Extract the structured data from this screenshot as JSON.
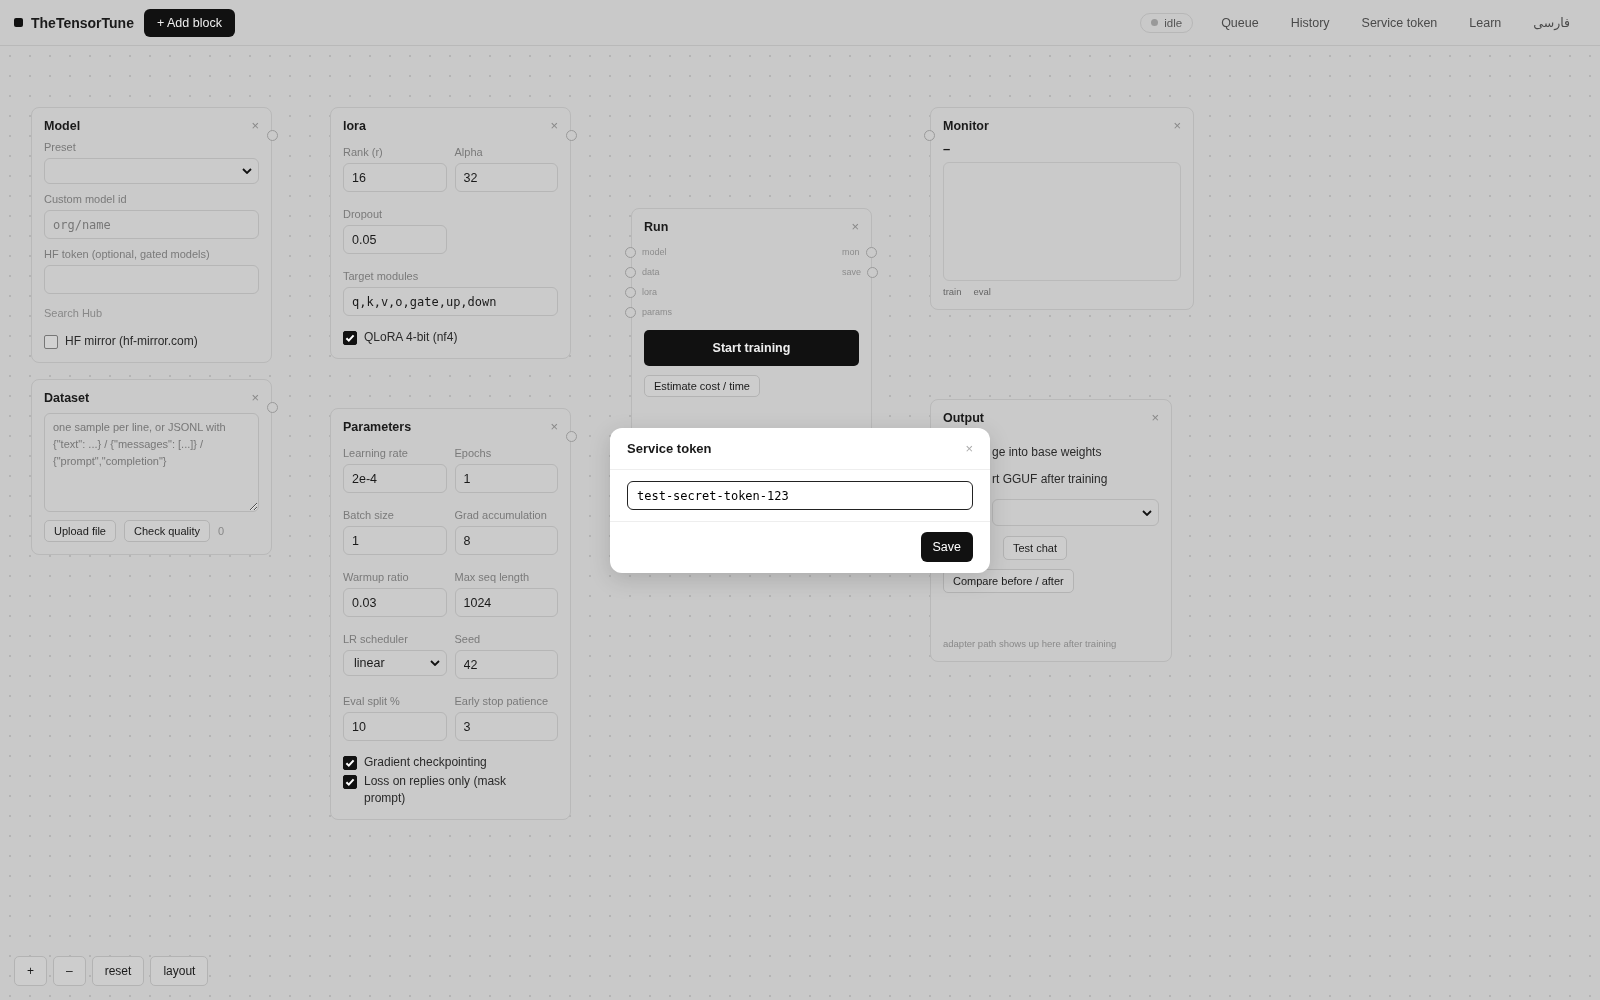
{
  "topbar": {
    "brand": "TheTensorTune",
    "add_block": "+ Add block",
    "status": "idle",
    "nav": [
      "Queue",
      "History",
      "Service token",
      "Learn",
      "فارسی"
    ]
  },
  "model": {
    "title": "Model",
    "close": "×",
    "preset": {
      "label": "Preset"
    },
    "custom_id": {
      "label": "Custom model id",
      "placeholder": "org/name"
    },
    "hf_token": {
      "label": "HF token (optional, gated models)"
    },
    "search_hub": "Search Hub",
    "mirror": {
      "label": "HF mirror (hf-mirror.com)",
      "checked": false
    }
  },
  "dataset": {
    "title": "Dataset",
    "close": "×",
    "text": {
      "placeholder": "one sample per line, or JSONL with\n{\"text\": ...} / {\"messages\": [...]} /\n{\"prompt\",\"completion\"}"
    },
    "upload": "Upload file",
    "check": "Check quality",
    "count": "0"
  },
  "lora": {
    "title": "lora",
    "close": "×",
    "fields": [
      {
        "label": "Rank (r)",
        "value": "16",
        "kind": "text"
      },
      {
        "label": "Alpha",
        "value": "32",
        "kind": "text"
      },
      {
        "label": "Dropout",
        "value": "0.05",
        "kind": "text"
      },
      {
        "label": "Target modules",
        "value": "q,k,v,o,gate,up,down",
        "kind": "mono"
      }
    ],
    "qlora": {
      "label": "QLoRA 4-bit (nf4)",
      "checked": true
    }
  },
  "parameters": {
    "title": "Parameters",
    "close": "×",
    "fields": [
      {
        "label": "Learning rate",
        "value": "2e-4",
        "kind": "text"
      },
      {
        "label": "Epochs",
        "value": "1",
        "kind": "text"
      },
      {
        "label": "Batch size",
        "value": "1",
        "kind": "text"
      },
      {
        "label": "Grad accumulation",
        "value": "8",
        "kind": "text"
      },
      {
        "label": "Warmup ratio",
        "value": "0.03",
        "kind": "text"
      },
      {
        "label": "Max seq length",
        "value": "1024",
        "kind": "text"
      },
      {
        "label": "LR scheduler",
        "value": "linear",
        "kind": "select"
      },
      {
        "label": "Seed",
        "value": "42",
        "kind": "text"
      },
      {
        "label": "Eval split %",
        "value": "10",
        "kind": "text"
      },
      {
        "label": "Early stop patience",
        "value": "3",
        "kind": "text"
      }
    ],
    "options": [
      {
        "label": "Gradient checkpointing",
        "checked": true
      },
      {
        "label": "Loss on replies only (mask prompt)",
        "checked": true
      }
    ]
  },
  "run": {
    "title": "Run",
    "close": "×",
    "inputs": [
      "model",
      "data",
      "lora",
      "params"
    ],
    "outputs": [
      "mon",
      "save"
    ],
    "start": "Start training",
    "estimate": "Estimate cost / time"
  },
  "monitor": {
    "title": "Monitor",
    "close": "×",
    "value": "–",
    "legend": [
      "train",
      "eval"
    ]
  },
  "output": {
    "title": "Output",
    "close": "×",
    "options": [
      "ge into base weights",
      "rt GGUF after training"
    ],
    "test_chat": "Test chat",
    "compare": "Compare before / after",
    "note": "adapter path shows up here after training"
  },
  "dialog": {
    "title": "Service token",
    "close": "×",
    "value": "test-secret-token-123",
    "save": "Save"
  },
  "zoom_controls": [
    "+",
    "–",
    "reset",
    "layout"
  ]
}
